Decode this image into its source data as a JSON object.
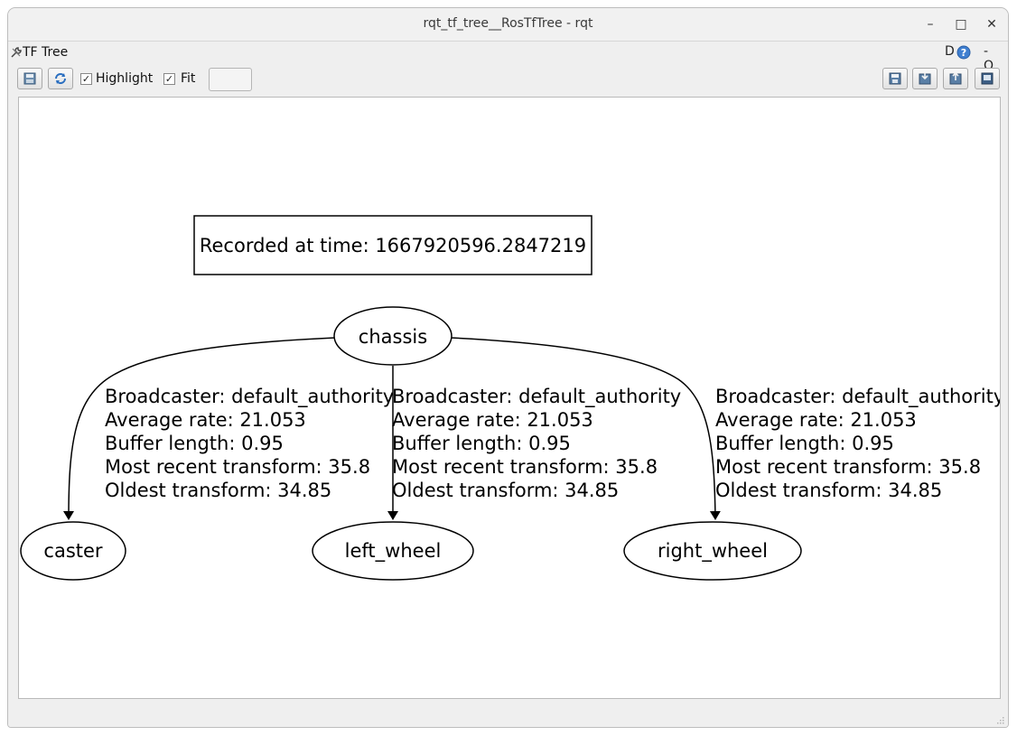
{
  "window": {
    "title": "rqt_tf_tree__RosTfTree - rqt",
    "controls": {
      "minimize": "–",
      "maximize": "□",
      "close": "✕"
    }
  },
  "plugin": {
    "title": "TF Tree",
    "help_label": "D",
    "extra_label": "- O"
  },
  "toolbar": {
    "highlight_label": "Highlight",
    "highlight_checked": true,
    "fit_label": "Fit",
    "fit_checked": true,
    "check_mark": "✓",
    "icons": [
      "save-dot-icon",
      "refresh-icon",
      "save-icon",
      "load-icon",
      "export-icon",
      "image-icon"
    ]
  },
  "graph": {
    "recorded_label": "Recorded at time: 1667920596.2847219",
    "root": "chassis",
    "children": [
      {
        "name": "caster",
        "broadcaster": "Broadcaster: default_authority",
        "average_rate": "Average rate: 21.053",
        "buffer_length": "Buffer length: 0.95",
        "most_recent": "Most recent transform: 35.8",
        "oldest": "Oldest transform: 34.85"
      },
      {
        "name": "left_wheel",
        "broadcaster": "Broadcaster: default_authority",
        "average_rate": "Average rate: 21.053",
        "buffer_length": "Buffer length: 0.95",
        "most_recent": "Most recent transform: 35.8",
        "oldest": "Oldest transform: 34.85"
      },
      {
        "name": "right_wheel",
        "broadcaster": "Broadcaster: default_authority",
        "average_rate": "Average rate: 21.053",
        "buffer_length": "Buffer length: 0.95",
        "most_recent": "Most recent transform: 35.8",
        "oldest": "Oldest transform: 34.85"
      }
    ]
  }
}
